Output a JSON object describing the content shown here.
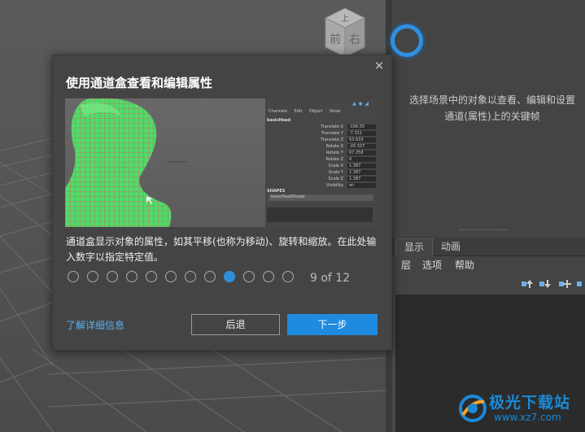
{
  "viewcube": {
    "face_top": "上",
    "face_front": "前",
    "face_right": "右"
  },
  "right_panel": {
    "hint_text": "选择场景中的对象以查看、编辑和设置通道(属性)上的关键帧",
    "tabs": [
      {
        "label": "显示",
        "active": true
      },
      {
        "label": "动画",
        "active": false
      }
    ],
    "menu": [
      "层",
      "选项",
      "帮助"
    ]
  },
  "dialog": {
    "title": "使用通道盒查看和编辑属性",
    "close_glyph": "✕",
    "description": "通道盒显示对象的属性，如其平移(也称为移动)、旋转和缩放。在此处输入数字以指定特定值。",
    "pager": {
      "current": 9,
      "total": 12,
      "label": "9 of 12"
    },
    "learn_more": "了解详细信息",
    "back_button": "后退",
    "next_button": "下一步",
    "accent_color": "#1e8be0"
  },
  "preview": {
    "menu": [
      "Channels",
      "Edit",
      "Object",
      "Show"
    ],
    "object_name": "basicHead",
    "attributes": [
      {
        "name": "Translate X",
        "value": "-106.55"
      },
      {
        "name": "Translate Y",
        "value": "-7.311"
      },
      {
        "name": "Translate Z",
        "value": "53.633"
      },
      {
        "name": "Rotate X",
        "value": "-20.327"
      },
      {
        "name": "Rotate Y",
        "value": "67.258"
      },
      {
        "name": "Rotate Z",
        "value": "0"
      },
      {
        "name": "Scale X",
        "value": "1.387"
      },
      {
        "name": "Scale Y",
        "value": "1.387"
      },
      {
        "name": "Scale Z",
        "value": "1.387"
      },
      {
        "name": "Visibility",
        "value": "on"
      }
    ],
    "shapes_label": "SHAPES",
    "shape_name": "basicHeadShape"
  },
  "watermark": {
    "title": "极光下载站",
    "url": "www.xz7.com"
  }
}
